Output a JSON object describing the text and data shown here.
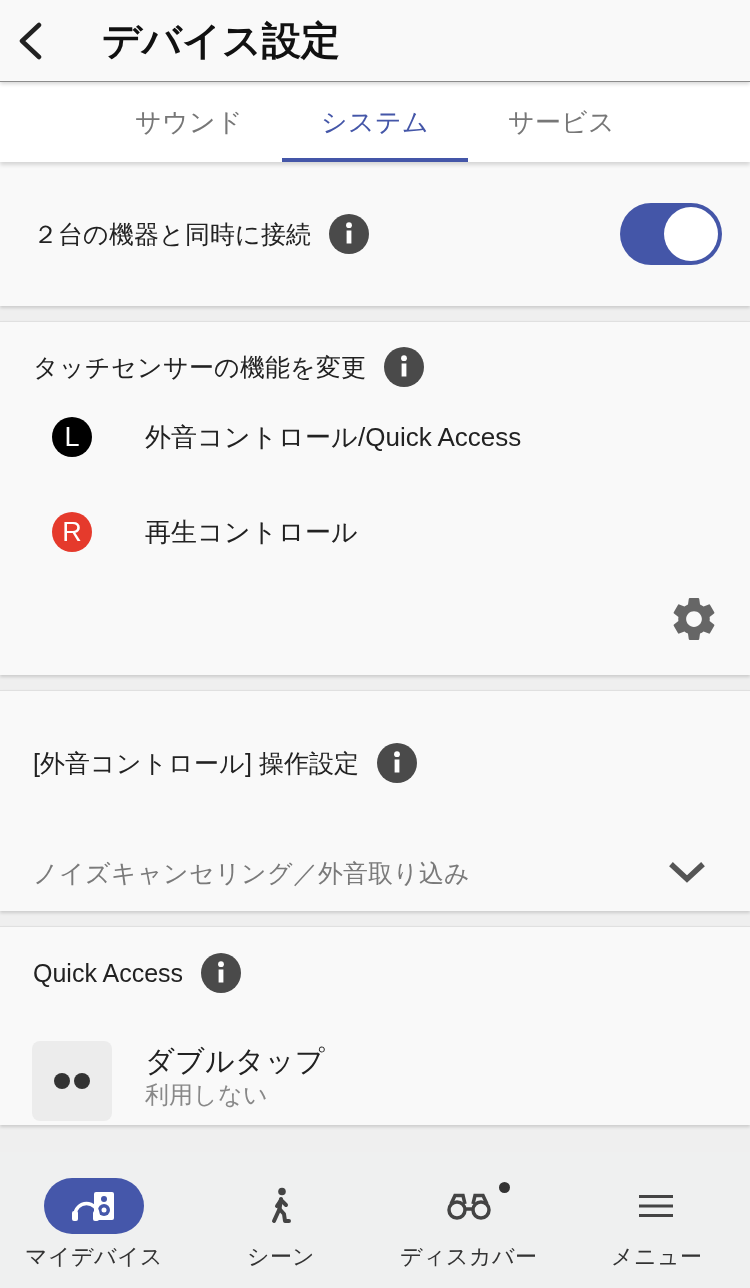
{
  "header": {
    "title": "デバイス設定"
  },
  "tabs": [
    {
      "label": "サウンド",
      "selected": false
    },
    {
      "label": "システム",
      "selected": true
    },
    {
      "label": "サービス",
      "selected": false
    }
  ],
  "sections": [
    {
      "kind": "toggle",
      "title": "２台の機器と同時に接続",
      "on": true
    },
    {
      "kind": "assignments",
      "title": "タッチセンサーの機能を変更",
      "items": [
        {
          "badge": "L",
          "label": "外音コントロール/Quick Access",
          "color": "#000000"
        },
        {
          "badge": "R",
          "label": "再生コントロール",
          "color": "#e53a2c"
        }
      ]
    },
    {
      "kind": "select",
      "title": "[外音コントロール] 操作設定",
      "value": "ノイズキャンセリング／外音取り込み"
    },
    {
      "kind": "list",
      "title": "Quick Access",
      "items": [
        {
          "label": "ダブルタップ",
          "value": "利用しない"
        }
      ]
    }
  ],
  "nav": [
    {
      "label": "マイデバイス",
      "selected": true,
      "dot": false
    },
    {
      "label": "シーン",
      "selected": false,
      "dot": false
    },
    {
      "label": "ディスカバー",
      "selected": false,
      "dot": true
    },
    {
      "label": "メニュー",
      "selected": false,
      "dot": false
    }
  ]
}
